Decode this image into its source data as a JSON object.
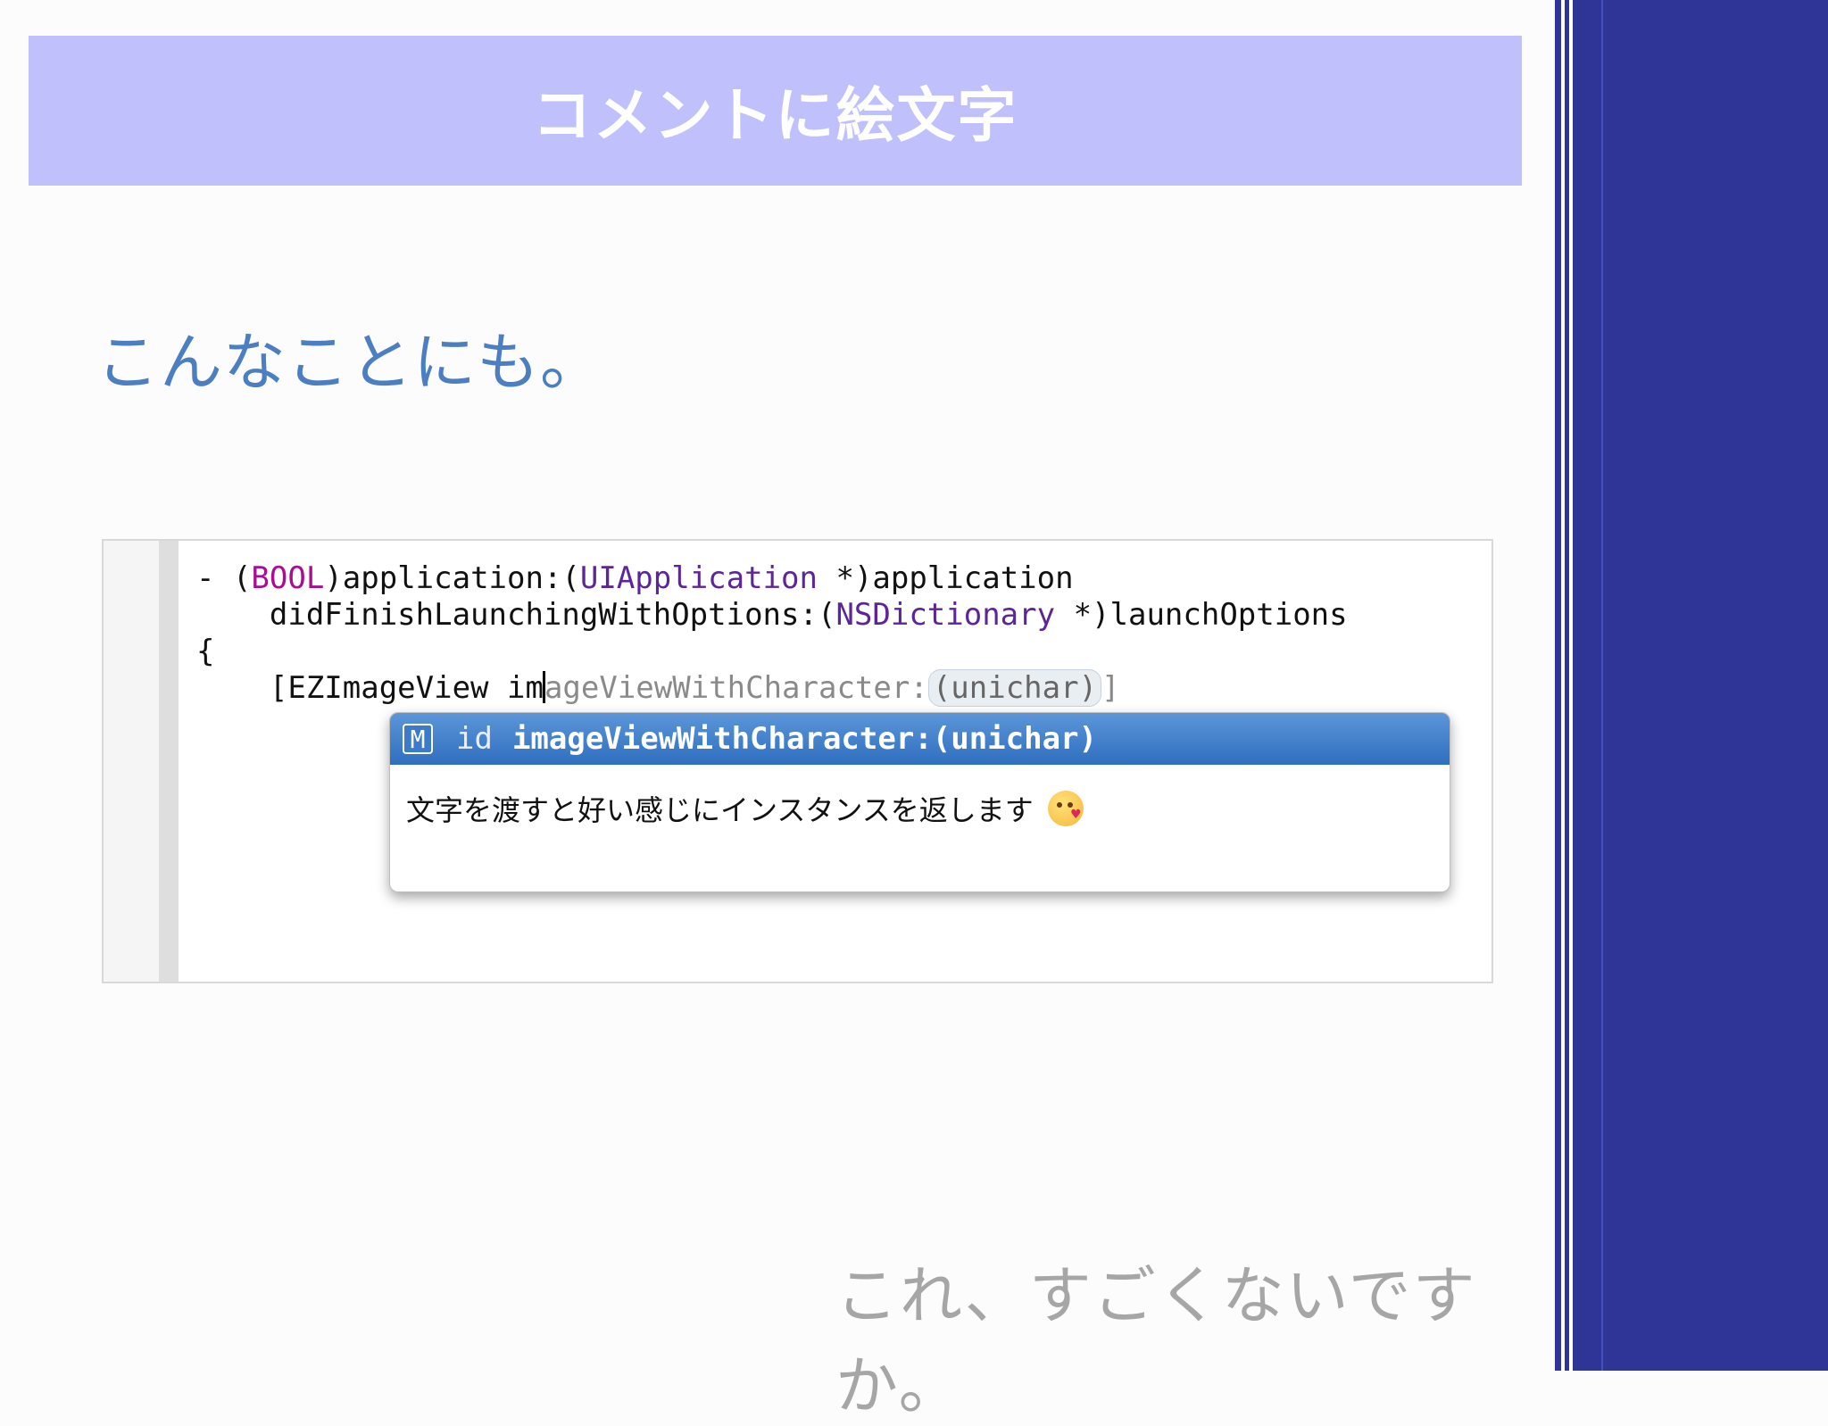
{
  "slide": {
    "title": "コメントに絵文字",
    "subtitle": "こんなことにも。",
    "footer": "これ、すごくないですか。"
  },
  "code": {
    "line1": {
      "dash": "- (",
      "type_bool": "BOOL",
      "mid1": ")application:(",
      "type_uiapp": "UIApplication",
      "end1": " *)application"
    },
    "line2": {
      "start": "    didFinishLaunchingWithOptions:(",
      "type_nsdict": "NSDictionary",
      "end": " *)launchOptions"
    },
    "line3": "{",
    "line4": {
      "typed": "    [EZImageView im",
      "completion_hint": "ageViewWithCharacter:",
      "placeholder": "(unichar)",
      "closing": "]"
    }
  },
  "autocomplete": {
    "badge": "M",
    "return_type": "id",
    "method": "imageViewWithCharacter:(unichar)",
    "description": "文字を渡すと好い感じにインスタンスを返します",
    "emoji_icon": "face-throwing-kiss-icon"
  },
  "colors": {
    "title_bar": "#c0c1fc",
    "subtitle_text": "#4c7fc2",
    "side_band": "#2f3597",
    "keyword": "#aa0d91",
    "type": "#5c2699",
    "selection": "#2f6fc0"
  }
}
